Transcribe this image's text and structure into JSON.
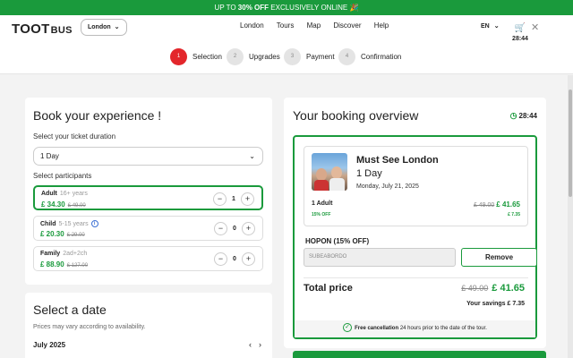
{
  "promo_bar": {
    "prefix": "UP TO",
    "highlight": "30% OFF",
    "suffix": "EXCLUSIVELY ONLINE",
    "icon": "party-icon"
  },
  "header": {
    "logo": {
      "part1": "TOOT",
      "part2": "BUS"
    },
    "city": "London",
    "nav": [
      "London",
      "Tours",
      "Map",
      "Discover",
      "Help"
    ],
    "language": "EN",
    "cart_timer": "28:44"
  },
  "steps": [
    {
      "num": "1",
      "label": "Selection",
      "active": true
    },
    {
      "num": "2",
      "label": "Upgrades",
      "active": false
    },
    {
      "num": "3",
      "label": "Payment",
      "active": false
    },
    {
      "num": "4",
      "label": "Confirmation",
      "active": false
    }
  ],
  "book": {
    "title": "Book your experience !",
    "duration_label": "Select your ticket duration",
    "duration_value": "1 Day",
    "participants_label": "Select participants",
    "participants": [
      {
        "name": "Adult",
        "age": "16+ years",
        "price": "£ 34.30",
        "old": "£ 49.00",
        "qty": "1"
      },
      {
        "name": "Child",
        "age": "5-15 years",
        "price": "£ 20.30",
        "old": "£ 29.00",
        "qty": "0"
      },
      {
        "name": "Family",
        "age": "2ad+2ch",
        "price": "£ 88.90",
        "old": "£ 127.00",
        "qty": "0"
      }
    ]
  },
  "date": {
    "title": "Select a date",
    "note": "Prices may vary according to availability.",
    "month": "July 2025"
  },
  "overview": {
    "title": "Your booking overview",
    "timer": "28:44",
    "tour_name": "Must See London",
    "tour_duration": "1 Day",
    "tour_date": "Monday, July 21, 2025",
    "line_item": "1 Adult",
    "line_old": "£ 49.00",
    "line_new": "£ 41.65",
    "line_discount": "15% OFF",
    "line_savings": "£ 7.35",
    "promo_label": "HOPON (15% OFF)",
    "promo_code": "SUBEABORDO",
    "remove_label": "Remove",
    "total_label": "Total price",
    "total_old": "£ 49.00",
    "total_new": "£ 41.65",
    "savings": "Your savings £ 7.35",
    "cancel_bold": "Free cancellation",
    "cancel_rest": "24 hours prior to the date of the tour."
  },
  "colors": {
    "accent": "#1a9a3c",
    "brand_red": "#e3262b"
  }
}
